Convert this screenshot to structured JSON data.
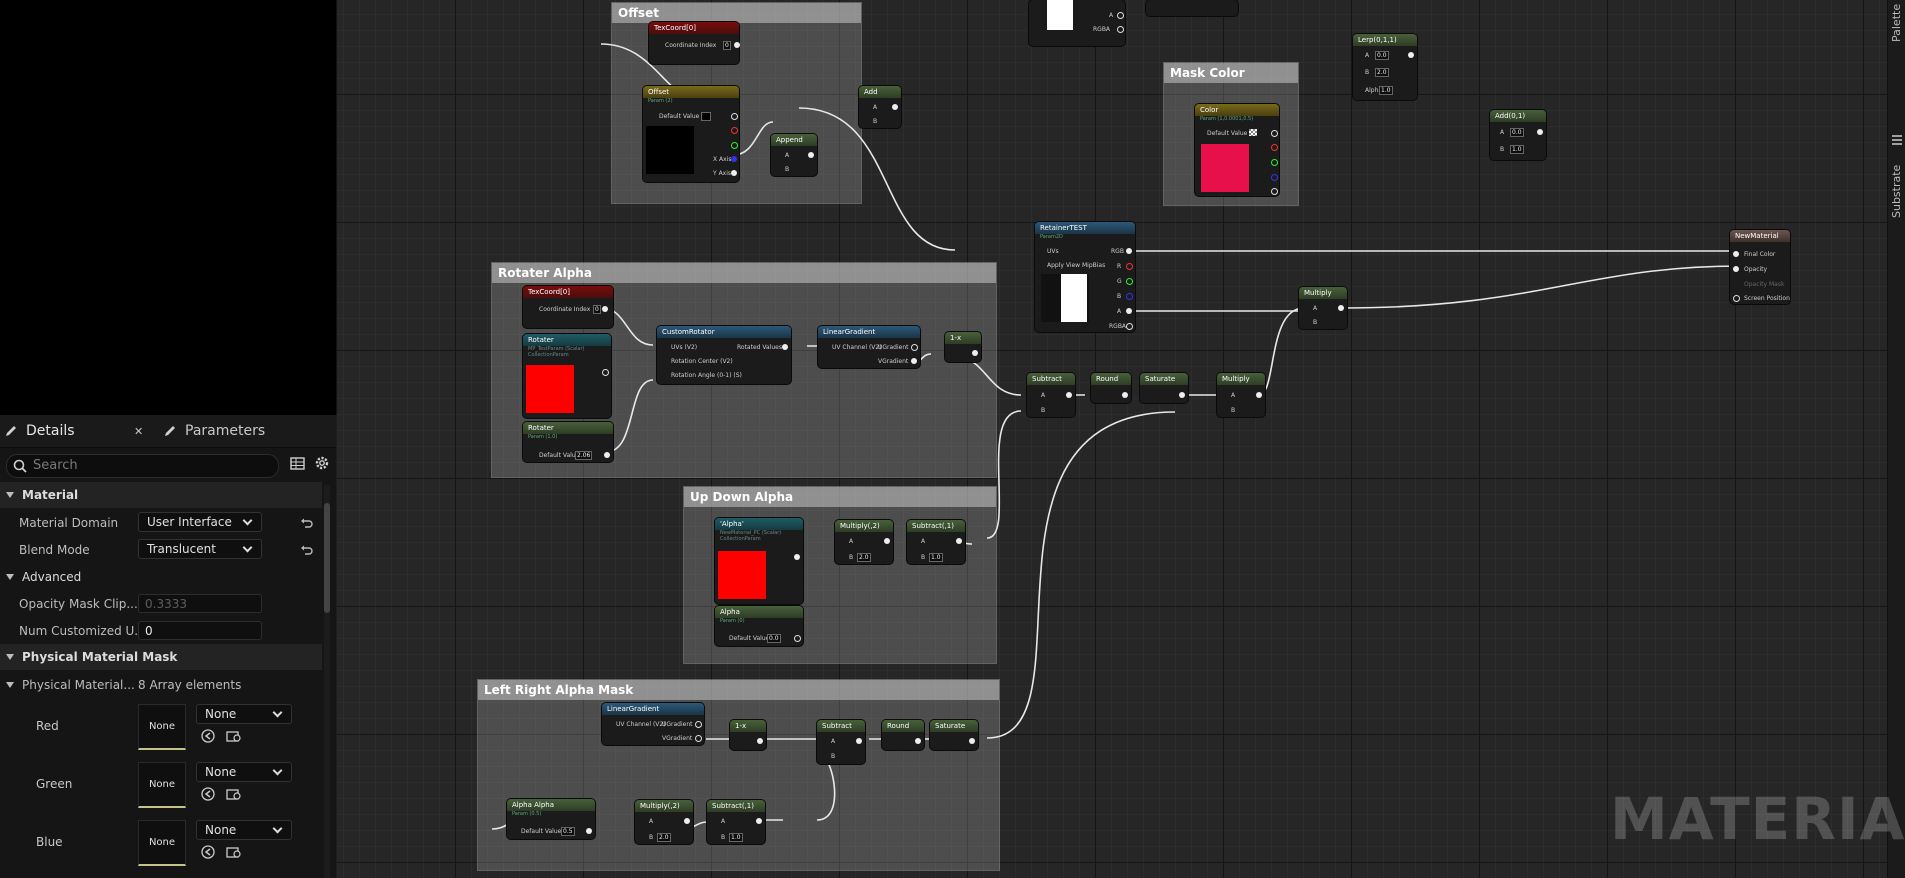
{
  "details": {
    "tabs": [
      {
        "label": "Details",
        "icon": "pencil-icon"
      },
      {
        "label": "Parameters",
        "icon": "pencil-icon"
      }
    ],
    "close_glyph": "✕",
    "search_placeholder": "Search",
    "sections": {
      "material": "Material",
      "advanced": "Advanced",
      "physical_mask": "Physical Material Mask"
    },
    "props": {
      "material_domain": {
        "label": "Material Domain",
        "value": "User Interface"
      },
      "blend_mode": {
        "label": "Blend Mode",
        "value": "Translucent"
      },
      "opacity_mask_clip": {
        "label": "Opacity Mask Clip...",
        "value": "0.3333"
      },
      "num_customized_uv": {
        "label": "Num Customized U...",
        "value": "0"
      },
      "physical_material": {
        "label": "Physical Material...",
        "value": "8 Array elements"
      }
    },
    "mask_entries": [
      {
        "label": "Red",
        "thumb": "None",
        "value": "None"
      },
      {
        "label": "Green",
        "thumb": "None",
        "value": "None"
      },
      {
        "label": "Blue",
        "thumb": "None",
        "value": "None"
      }
    ]
  },
  "right_tabs": {
    "palette": "Palette",
    "substrate": "Substrate"
  },
  "watermark": "MATERIAL",
  "comments": {
    "offset": "Offset",
    "mask_color": "Mask Color",
    "rotater_alpha": "Rotater Alpha",
    "up_down_alpha": "Up Down Alpha",
    "left_right": "Left Right Alpha Mask"
  },
  "nodes": {
    "texcoord1": {
      "title": "TexCoord[0]",
      "label": "Coordinate Index",
      "value": "0"
    },
    "offset_param": {
      "title": "Offset",
      "sub": "Param (2)",
      "default_label": "Default Value",
      "x": "X Axis",
      "y": "Y Axis"
    },
    "append": {
      "title": "Append",
      "a": "A",
      "b": "B"
    },
    "add1": {
      "title": "Add",
      "a": "A",
      "b": "B"
    },
    "lerp": {
      "title": "Lerp(0,1,1)",
      "a": "A",
      "a_val": "0.0",
      "b": "B",
      "b_val": "2.0",
      "alpha": "Alpha",
      "alpha_val": "1.0"
    },
    "add2": {
      "title": "Add(0,1)",
      "a": "A",
      "a_val": "0.0",
      "b": "B",
      "b_val": "1.0"
    },
    "top_mid": {
      "a": "A",
      "rgba": "RGBA"
    },
    "color_param": {
      "title": "Color",
      "sub": "Param (1,0.0001,0.5)",
      "default_label": "Default Value"
    },
    "retainer": {
      "title": "RetainerTEST",
      "sub": "Param2D",
      "uvs": "UVs",
      "apply": "Apply View MipBias",
      "rgb": "RGB",
      "r": "R",
      "g": "G",
      "b": "B",
      "a": "A",
      "rgba": "RGBA"
    },
    "new_material": {
      "title": "NewMaterial",
      "final": "Final Color",
      "opacity": "Opacity",
      "mask": "Opacity Mask",
      "screen": "Screen Position"
    },
    "multiply_top": {
      "title": "Multiply",
      "a": "A",
      "b": "B"
    },
    "texcoord2": {
      "title": "TexCoord[0]",
      "label": "Coordinate Index",
      "value": "0"
    },
    "rotater": {
      "title": "Rotater",
      "sub": "MP_TestParam (Scalar) CollectionParam"
    },
    "rotater_param": {
      "title": "Rotater",
      "sub": "Param (1.0)",
      "default_label": "Default Value",
      "value": "2.06"
    },
    "custom_rotator": {
      "title": "CustomRotator",
      "uvs": "UVs (V2)",
      "center": "Rotation Center (V2)",
      "angle": "Rotation Angle (0-1) (S)",
      "out": "Rotated Values"
    },
    "linear_gradient1": {
      "title": "LinearGradient",
      "uv": "UV Channel (V2)",
      "u": "UGradient",
      "v": "VGradient"
    },
    "one_minus1": {
      "title": "1-x"
    },
    "subtract1": {
      "title": "Subtract",
      "a": "A",
      "b": "B"
    },
    "round1": {
      "title": "Round"
    },
    "saturate1": {
      "title": "Saturate"
    },
    "multiply_mid": {
      "title": "Multiply",
      "a": "A",
      "b": "B"
    },
    "alpha_coll": {
      "title": "'Alpha'",
      "sub": "NewMaterial_PC (Scalar) CollectionParam"
    },
    "alpha_param": {
      "title": "Alpha",
      "sub": "Param (0)",
      "default_label": "Default Value",
      "value": "0.0"
    },
    "multiply2": {
      "title": "Multiply(,2)",
      "a": "A",
      "b": "B",
      "b_val": "2.0"
    },
    "subtract2": {
      "title": "Subtract(,1)",
      "a": "A",
      "b": "B",
      "b_val": "1.0"
    },
    "linear_gradient2": {
      "title": "LinearGradient",
      "uv": "UV Channel (V2)",
      "u": "UGradient",
      "v": "VGradient"
    },
    "one_minus2": {
      "title": "1-x"
    },
    "subtract3": {
      "title": "Subtract",
      "a": "A",
      "b": "B"
    },
    "round2": {
      "title": "Round"
    },
    "saturate2": {
      "title": "Saturate"
    },
    "alpha_alpha": {
      "title": "Alpha Alpha",
      "sub": "Param (0.5)",
      "default_label": "Default Value",
      "value": "0.5"
    },
    "multiply3": {
      "title": "Multiply(,2)",
      "a": "A",
      "b": "B",
      "b_val": "2.0"
    },
    "subtract4": {
      "title": "Subtract(,1)",
      "a": "A",
      "b": "B",
      "b_val": "1.0"
    }
  },
  "colors": {
    "accent_red": "#ff0000",
    "mask_pink": "#e8104a",
    "panel": "#151515"
  }
}
